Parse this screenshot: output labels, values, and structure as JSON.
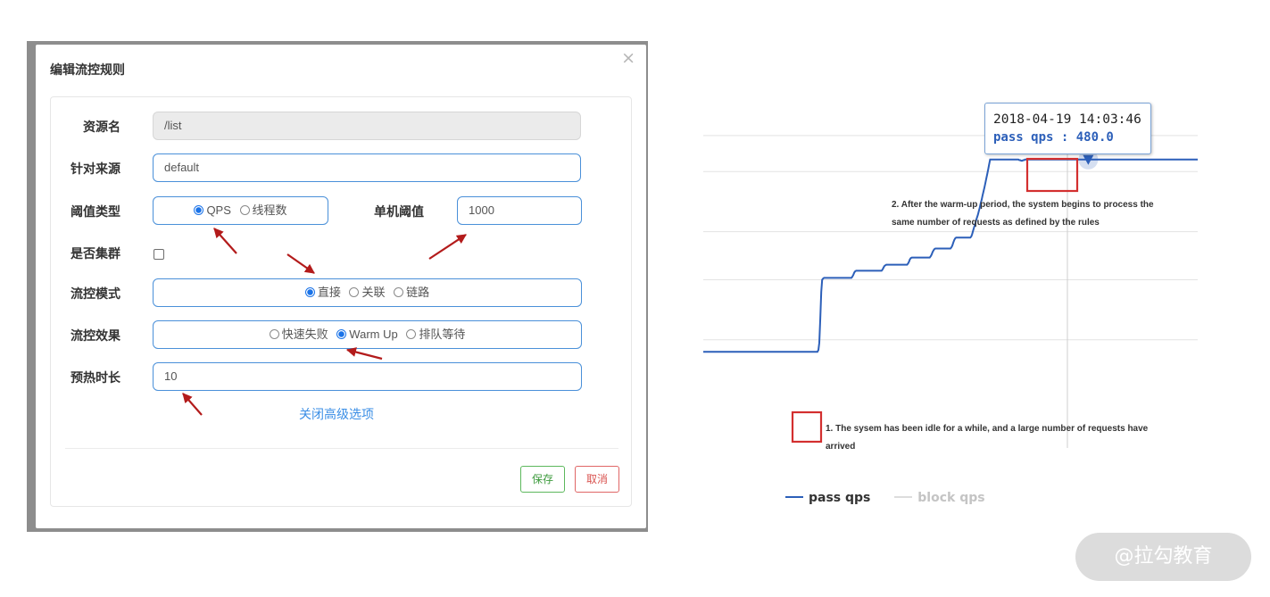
{
  "dialog": {
    "title": "编辑流控规则",
    "close_glyph": "×",
    "resource": {
      "label": "资源名",
      "value": "/list"
    },
    "origin": {
      "label": "针对来源",
      "value": "default"
    },
    "threshold_type": {
      "label": "阈值类型",
      "options": [
        "QPS",
        "线程数"
      ],
      "selected": "QPS"
    },
    "single_threshold": {
      "label": "单机阈值",
      "value": "1000"
    },
    "cluster": {
      "label": "是否集群",
      "checked": false
    },
    "flow_mode": {
      "label": "流控模式",
      "options": [
        "直接",
        "关联",
        "链路"
      ],
      "selected": "直接"
    },
    "flow_effect": {
      "label": "流控效果",
      "options": [
        "快速失败",
        "Warm Up",
        "排队等待"
      ],
      "selected": "Warm Up"
    },
    "warmup": {
      "label": "预热时长",
      "value": "10"
    },
    "advanced_link": "关闭高级选项",
    "save_label": "保存",
    "cancel_label": "取消"
  },
  "colors": {
    "arrow": "#b31b1b",
    "pass_qps": "#2c5fb9",
    "block_qps": "#cccccc",
    "highlight_box": "#d32f2f",
    "field_border": "#4a90d9"
  },
  "tooltip": {
    "time": "2018-04-19 14:03:46",
    "value": "pass qps : 480.0"
  },
  "annotations": {
    "warmup_done": [
      "2. After the warm-up period, the system begins to process the",
      "same number of requests as defined by the rules"
    ],
    "idle": [
      "1. The sysem has been idle for a while, and a large number of requests have",
      "arrived"
    ]
  },
  "watermark": "@拉勾教育",
  "chart_data": {
    "type": "line",
    "title": "",
    "xlabel": "",
    "ylabel": "",
    "grid": true,
    "legend": "bottom-left",
    "series": [
      {
        "name": "pass qps",
        "color": "#2c5fb9",
        "values": [
          160,
          160,
          160,
          160,
          160,
          160,
          160,
          160,
          160,
          160,
          160,
          160,
          160,
          160,
          160,
          160,
          160,
          160,
          160,
          160,
          160,
          160,
          160,
          160,
          160,
          160,
          160,
          160,
          160,
          160,
          160,
          160,
          160,
          160,
          160,
          160,
          160,
          160,
          160,
          160,
          160,
          160,
          160,
          160,
          160,
          160,
          160,
          160,
          160,
          160,
          160,
          160,
          160,
          160,
          160,
          160,
          160,
          160,
          160,
          160,
          160,
          160,
          160,
          160,
          160,
          160,
          160,
          160,
          160,
          160,
          160,
          160,
          160,
          160,
          160,
          160,
          160,
          160,
          160,
          160,
          160,
          160,
          160,
          160,
          160,
          160,
          160,
          160,
          160,
          160,
          160,
          160,
          160,
          160,
          160,
          160,
          160,
          160,
          160,
          160,
          160,
          160,
          160,
          160,
          160,
          160,
          160,
          160,
          160,
          160,
          160,
          160,
          160,
          160,
          160,
          160,
          160,
          160,
          160,
          160,
          160,
          160,
          163,
          175,
          215,
          260,
          280,
          282,
          283,
          283,
          283,
          283,
          283,
          283,
          283,
          283,
          283,
          283,
          283,
          283,
          283,
          283,
          283,
          283,
          283,
          283,
          283,
          283,
          283,
          283,
          283,
          283,
          283,
          283,
          283,
          283,
          283,
          283,
          285,
          288,
          292,
          294,
          295,
          295,
          295,
          295,
          295,
          295,
          295,
          295,
          295,
          295,
          295,
          295,
          295,
          295,
          295,
          295,
          295,
          295,
          295,
          295,
          295,
          295,
          295,
          295,
          295,
          295,
          295,
          295,
          297,
          300,
          303,
          304,
          305,
          305,
          305,
          305,
          305,
          305,
          305,
          305,
          305,
          305,
          305,
          305,
          305,
          305,
          305,
          305,
          305,
          305,
          305,
          305,
          305,
          305,
          305,
          307,
          310,
          314,
          316,
          317,
          317,
          317,
          317,
          317,
          317,
          317,
          317,
          317,
          317,
          317,
          317,
          317,
          317,
          317,
          317,
          317,
          317,
          317,
          317,
          319,
          322,
          326,
          329,
          331,
          332,
          332,
          332,
          332,
          332,
          332,
          332,
          332,
          332,
          332,
          332,
          332,
          332,
          332,
          332,
          332,
          332,
          334,
          337,
          342,
          346,
          349,
          350,
          350,
          350,
          350,
          350,
          350,
          350,
          350,
          350,
          350,
          350,
          350,
          350,
          350,
          350,
          350,
          352,
          356,
          362,
          367,
          372,
          378,
          383,
          388,
          394,
          400,
          407,
          413,
          420,
          427,
          434,
          441,
          449,
          456,
          464,
          472,
          480,
          480,
          480,
          480,
          480,
          480,
          480,
          480,
          480,
          480,
          480,
          480,
          480,
          480,
          480,
          480,
          480,
          480,
          480,
          480,
          480,
          480,
          480,
          480,
          480,
          480,
          480,
          480,
          480,
          480,
          480,
          479,
          479,
          478,
          478,
          479,
          479,
          480,
          480,
          480,
          480,
          480,
          480,
          480,
          480,
          480,
          480,
          480,
          480,
          480,
          480,
          480,
          480,
          480,
          480,
          480,
          480,
          480,
          480,
          480,
          480,
          480,
          480,
          480,
          480,
          480,
          480,
          480,
          480,
          480,
          480,
          480,
          480,
          480,
          480,
          480,
          480,
          480,
          480,
          480,
          480,
          480,
          480,
          480,
          480,
          480,
          480,
          480,
          480,
          480,
          480,
          480,
          480,
          480,
          480,
          480,
          480,
          480,
          480,
          480,
          480,
          480,
          480,
          480,
          480,
          480,
          480,
          480,
          480,
          480,
          480,
          480,
          480,
          480,
          480,
          480,
          480,
          480,
          480,
          480,
          480,
          480,
          480,
          480,
          480,
          480,
          480,
          480,
          480,
          480,
          480,
          480,
          480,
          480,
          480,
          480,
          480,
          480,
          480,
          480,
          480,
          480,
          480,
          480,
          480,
          480,
          480,
          480,
          480,
          480,
          480,
          480,
          480,
          480,
          480,
          480,
          480,
          480,
          480,
          480,
          480,
          480,
          480,
          480,
          480,
          480,
          480,
          480,
          480,
          480,
          480,
          480,
          480,
          480,
          480,
          480,
          480,
          480,
          480,
          480,
          480,
          480,
          480,
          480,
          480,
          480,
          480,
          480,
          480,
          480,
          480,
          480,
          480,
          480,
          480,
          480,
          480,
          480,
          480,
          480,
          480,
          480,
          480,
          480,
          480,
          480,
          480,
          480,
          480,
          480,
          480,
          480,
          480,
          480,
          480,
          480,
          480,
          480,
          480,
          480,
          480
        ]
      },
      {
        "name": "block qps",
        "color": "#cccccc",
        "values": []
      }
    ],
    "ylim": [
      0,
      600
    ],
    "highlight_index": 408
  }
}
